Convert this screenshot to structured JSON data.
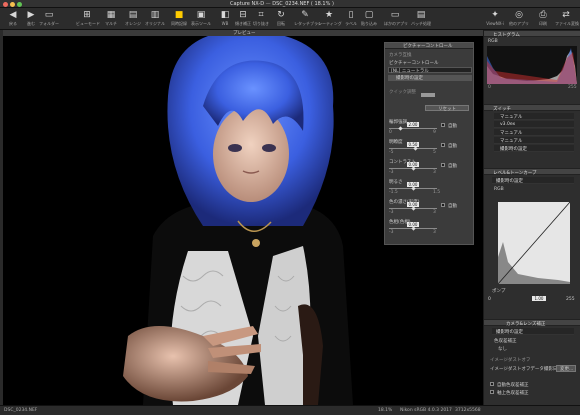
{
  "window": {
    "title": "Capture NX-D",
    "subtitle": "DSC_0234.NEF ( 18.1% )"
  },
  "toolbar": {
    "items": [
      {
        "label": "戻る",
        "icon": "back-arrow"
      },
      {
        "label": "進む",
        "icon": "forward-arrow"
      },
      {
        "label": "フォルダー",
        "icon": "folder"
      },
      {
        "label": "ビューモード",
        "icon": "view-mode"
      },
      {
        "label": "マルチ",
        "icon": "multi"
      },
      {
        "label": "オレンジ",
        "icon": "label"
      },
      {
        "label": "オリジナル",
        "icon": "original"
      },
      {
        "label": "同時記録",
        "icon": "simultaneous"
      },
      {
        "label": "表示ツール",
        "icon": "display-tool"
      },
      {
        "label": "WB",
        "icon": "wb"
      },
      {
        "label": "傾き補正",
        "icon": "straighten"
      },
      {
        "label": "切り抜き",
        "icon": "crop"
      },
      {
        "label": "回転",
        "icon": "rotate"
      },
      {
        "label": "レタッチブラシ",
        "icon": "retouch"
      },
      {
        "label": "レーティング",
        "icon": "rating-star"
      },
      {
        "label": "ラベル",
        "icon": "label-tag"
      },
      {
        "label": "貼り込み",
        "icon": "paste"
      },
      {
        "label": "ほかのアプリ",
        "icon": "other-app"
      },
      {
        "label": "バッチ処理",
        "icon": "batch"
      },
      {
        "label": "ViewNX-i",
        "icon": "viewnx"
      },
      {
        "label": "他のアプリ",
        "icon": "open-with"
      },
      {
        "label": "印刷",
        "icon": "print"
      },
      {
        "label": "ファイル変換",
        "icon": "convert"
      }
    ]
  },
  "viewer": {
    "header_label": "プレビュー"
  },
  "picture_control": {
    "title": "ピクチャーコントロール",
    "sub_label": "カメラ互換",
    "section": "ピクチャーコントロール",
    "dropdown_value": "[NL] ニュートラル",
    "preset_row": "撮影時の設定",
    "quick_adjust_label": "クイック調整",
    "reset_label": "リセット",
    "sliders": [
      {
        "label": "輪郭強調",
        "value": "2.00",
        "auto": "自動",
        "min": "0",
        "max": "9",
        "fraction": 0.22
      },
      {
        "label": "明瞭度",
        "value": "0.50",
        "auto": "自動",
        "min": "-5",
        "max": "5",
        "fraction": 0.55
      },
      {
        "label": "コントラスト",
        "value": "0.00",
        "auto": "自動",
        "min": "-3",
        "max": "3",
        "fraction": 0.5
      },
      {
        "label": "明るさ",
        "value": "0.00",
        "auto": "",
        "min": "-1.5",
        "max": "1.5",
        "fraction": 0.5
      },
      {
        "label": "色の濃さ(彩度)",
        "value": "0.00",
        "auto": "自動",
        "min": "-3",
        "max": "3",
        "fraction": 0.5
      },
      {
        "label": "色相(色相)",
        "value": "0.00",
        "auto": "",
        "min": "-3",
        "max": "3",
        "fraction": 0.5
      }
    ]
  },
  "right_panel": {
    "histogram_title": "ヒストグラム",
    "histogram_channel": "RGB",
    "histogram_min": "0",
    "histogram_max": "255",
    "adjust_title": "ズイッチ",
    "adjust_rows": [
      "マニュアル",
      "v3.0ex",
      "マニュアル",
      "マニュアル",
      "撮影時の設定"
    ],
    "levels_title": "レベル&トーンカーブ",
    "levels_preset": "撮影時の設定",
    "levels_channel": "RGB",
    "levels_input_label": "ポンプ",
    "levels_values": [
      "0",
      "1.00",
      "255"
    ],
    "lens_title": "カメラ&レンズ補正",
    "lens_preset": "撮影時の設定",
    "lens_rows": [
      "色収差補正",
      "なし"
    ],
    "image_dust_title": "イメージダストオフ",
    "image_dust_value": "イメージダストオフデータ撮影日時:",
    "image_dust_button": "変更...",
    "lens_checks": [
      "自動色収差補正",
      "軸上色収差補正"
    ]
  },
  "statusbar": {
    "filename": "DSC_0234.NEF",
    "zoom": "18.1%",
    "camera": "Nikon sRGB 4.0.3 2017",
    "size": "3712x5568"
  },
  "colors": {
    "accent": "#ffcc00",
    "background": "#1b1b1b",
    "panel": "#3b3b3b",
    "hair": "#3f6fe0"
  }
}
